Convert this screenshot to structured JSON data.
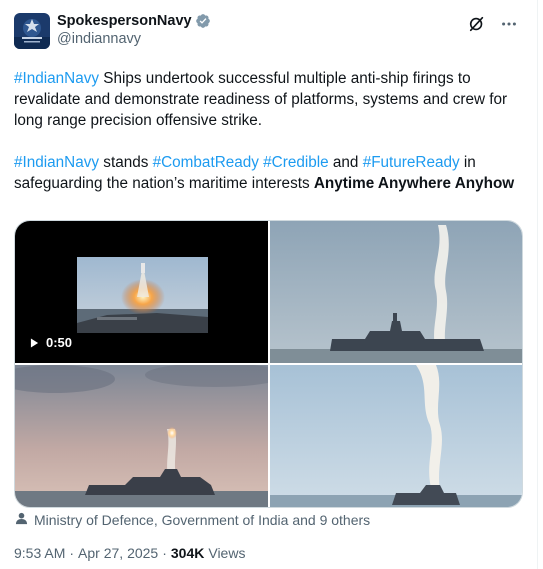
{
  "author": {
    "display_name": "SpokespersonNavy",
    "handle": "@indiannavy",
    "verified": true,
    "avatar_icon": "navy-crest-logo"
  },
  "header_actions": {
    "grok_icon": "grok-icon",
    "more_icon": "more-icon"
  },
  "tweet": {
    "p1": {
      "hashtag": "#IndianNavy",
      "text": " Ships undertook successful multiple anti-ship firings to revalidate and demonstrate readiness of platforms, systems and crew for long range precision offensive strike."
    },
    "p2": {
      "hashtag1": "#IndianNavy",
      "text1": " stands ",
      "hashtag2": "#CombatReady",
      "text2": " ",
      "hashtag3": "#Credible",
      "text3": " and ",
      "hashtag4": "#FutureReady",
      "text4": " in safeguarding the nation’s maritime interests ",
      "bold": "Anytime Anywhere Anyhow"
    }
  },
  "media": {
    "video_duration": "0:50",
    "play_icon": "play-icon"
  },
  "tagged": {
    "icon": "person-icon",
    "text": "Ministry of Defence, Government of India and 9 others"
  },
  "meta": {
    "time": "9:53 AM",
    "separator": "·",
    "date": "Apr 27, 2025",
    "views_count": "304K",
    "views_label": "Views"
  },
  "colors": {
    "link": "#1d9bf0",
    "secondary_text": "#536471",
    "primary_text": "#0f1419",
    "verified": "#829aab"
  }
}
